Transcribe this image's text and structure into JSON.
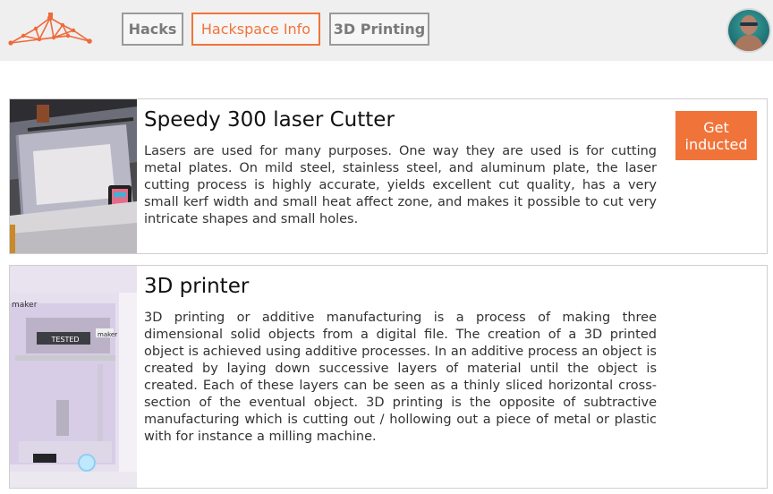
{
  "nav": {
    "tabs": [
      {
        "label": "Hacks",
        "active": false
      },
      {
        "label": "Hackspace Info",
        "active": true
      },
      {
        "label": "3D Printing",
        "active": false
      }
    ]
  },
  "colors": {
    "accent": "#f0743a",
    "nav_border": "#9a9a9a",
    "topbar_bg": "#efefef"
  },
  "items": [
    {
      "title": "Speedy 300 laser Cutter",
      "description": "Lasers are used for many purposes. One way they are used is for cutting metal plates. On mild steel, stainless steel, and aluminum plate, the laser cutting process is highly accurate, yields excellent cut quality, has a very small kerf width and small heat affect zone, and makes it possible to cut very intricate shapes and small holes.",
      "cta_label": "Get inducted"
    },
    {
      "title": "3D printer",
      "description": "3D printing or additive manufacturing is a process of making three dimensional solid objects from a digital file. The creation of a 3D printed object is achieved using additive processes. In an additive process an object is created by laying down successive layers of material until the object is created. Each of these layers can be seen as a thinly sliced horizontal cross-section of the eventual object. 3D printing is the opposite of subtractive manufacturing which is cutting out / hollowing out a piece of metal or plastic with for instance a milling machine.",
      "image_labels": [
        "maker",
        "TESTED",
        "maker"
      ]
    }
  ]
}
